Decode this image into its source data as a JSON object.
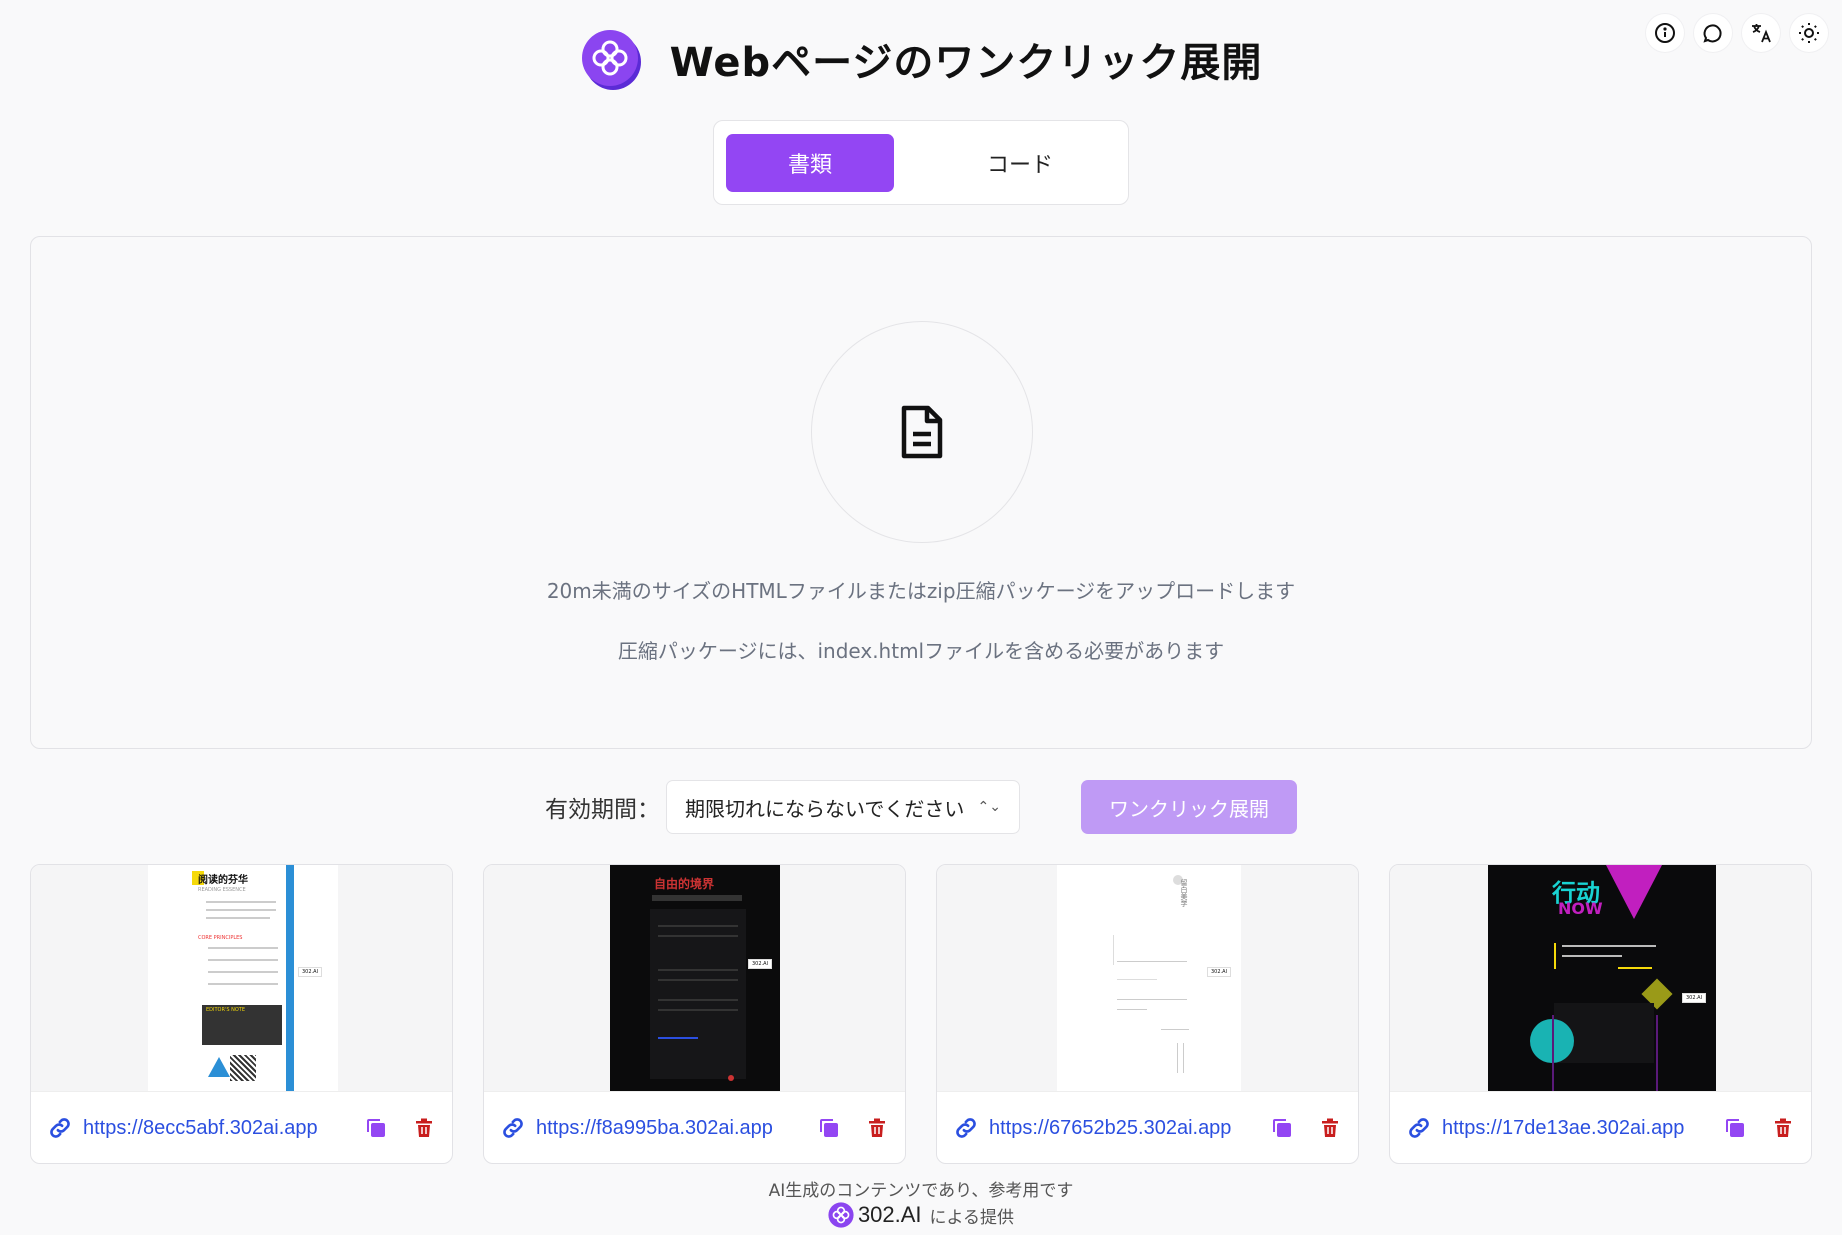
{
  "header": {
    "title": "Webページのワンクリック展開"
  },
  "tabs": [
    {
      "label": "書類",
      "active": true
    },
    {
      "label": "コード",
      "active": false
    }
  ],
  "upload": {
    "line1": "20m未満のサイズのHTMLファイルまたはzip圧縮パッケージをアップロードします",
    "line2": "圧縮パッケージには、index.htmlファイルを含める必要があります"
  },
  "expiry": {
    "label": "有効期間：",
    "selected": "期限切れにならないでください",
    "deploy_label": "ワンクリック展開"
  },
  "cards": [
    {
      "url": "https://8ecc5abf.302ai.app"
    },
    {
      "url": "https://f8a995ba.302ai.app"
    },
    {
      "url": "https://67652b25.302ai.app"
    },
    {
      "url": "https://17de13ae.302ai.app"
    }
  ],
  "thumbnails": {
    "t1_title": "阅读的芬华",
    "t1_sub": "READING ESSENCE",
    "t1_section": "CORE PRINCIPLES",
    "t1_note": "EDITOR'S NOTE",
    "t2_title": "自由的境界",
    "t3_title": "留白美学",
    "t4_title": "行动",
    "t4_sub": "NOW",
    "badge": "302.AI"
  },
  "footer": {
    "line1": "AI生成のコンテンツであり、参考用です",
    "brand": "302.AI",
    "provided": "による提供"
  },
  "colors": {
    "accent": "#9346f3",
    "accent_light": "#bf9af5",
    "link": "#2b4fe0",
    "delete": "#c81e1e"
  }
}
